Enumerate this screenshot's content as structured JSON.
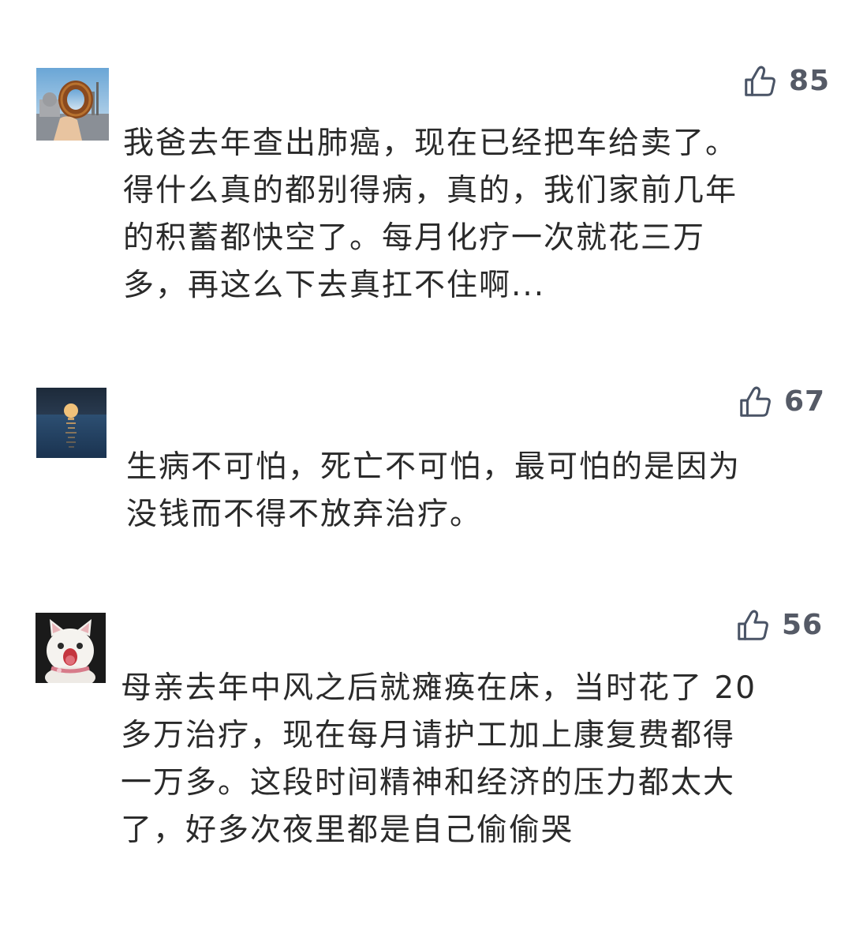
{
  "comments": [
    {
      "avatar_icon": "bagel-photo-avatar",
      "likes": "85",
      "lines": [
        "我爸去年查出肺癌，现在已经把车给卖了。",
        "得什么真的都别得病，真的，我们家前几年",
        "的积蓄都快空了。每月化疗一次就花三万",
        "多，再这么下去真扛不住啊..."
      ]
    },
    {
      "avatar_icon": "moon-over-sea-avatar",
      "likes": "67",
      "lines": [
        "生病不可怕，死亡不可怕，最可怕的是因为",
        "没钱而不得不放弃治疗。"
      ]
    },
    {
      "avatar_icon": "white-cat-avatar",
      "likes": "56",
      "lines": [
        "母亲去年中风之后就瘫痪在床，当时花了 20",
        "多万治疗，现在每月请护工加上康复费都得",
        "一万多。这段时间精神和经济的压力都太大",
        "了，好多次夜里都是自己偷偷哭"
      ]
    }
  ],
  "colors": {
    "like_count": "#555a66",
    "like_icon_stroke": "#4a5466",
    "comment_text": "#2a2a2a"
  },
  "like_icon": "thumbs-up-icon"
}
